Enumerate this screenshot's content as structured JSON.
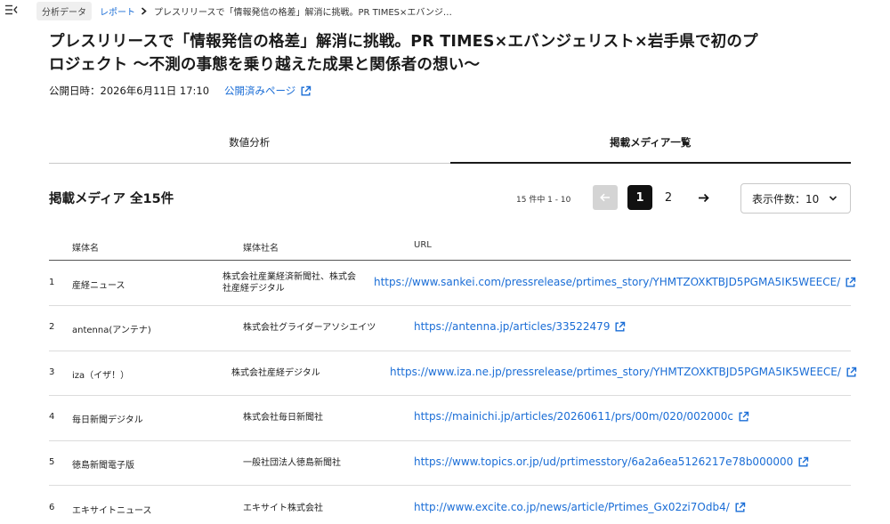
{
  "breadcrumb": {
    "root": "分析データ",
    "report": "レポート",
    "current": "プレスリリースで「情報発信の格差」解消に挑戦。PR TIMES×エバンジ…"
  },
  "page_title": "プレスリリースで「情報発信の格差」解消に挑戦。PR TIMES×エバンジェリスト×岩手県で初のプロジェクト 〜不測の事態を乗り越えた成果と関係者の想い〜",
  "meta": {
    "published": "公開日時：2026年6月11日 17:10",
    "published_page_link": "公開済みページ"
  },
  "tabs": [
    {
      "label": "数値分析",
      "active": false
    },
    {
      "label": "掲載メディア一覧",
      "active": true
    }
  ],
  "list": {
    "count_label": "掲載メディア 全15件",
    "range_label": "15 件中 1 - 10",
    "pages": [
      "1",
      "2"
    ],
    "current_page": "1",
    "per_page_label": "表示件数：10"
  },
  "table": {
    "headers": [
      "媒体名",
      "媒体社名",
      "URL"
    ],
    "rows": [
      {
        "num": "1",
        "media": "産経ニュース",
        "company": "株式会社産業経済新聞社、株式会社産経デジタル",
        "url": "https://www.sankei.com/pressrelease/prtimes_story/YHMTZOXKTBJD5PGMA5IK5WEECE/"
      },
      {
        "num": "2",
        "media": "antenna(アンテナ)",
        "company": "株式会社グライダーアソシエイツ",
        "url": "https://antenna.jp/articles/33522479"
      },
      {
        "num": "3",
        "media": "iza（イザ！）",
        "company": "株式会社産経デジタル",
        "url": "https://www.iza.ne.jp/pressrelease/prtimes_story/YHMTZOXKTBJD5PGMA5IK5WEECE/"
      },
      {
        "num": "4",
        "media": "毎日新聞デジタル",
        "company": "株式会社毎日新聞社",
        "url": "https://mainichi.jp/articles/20260611/prs/00m/020/002000c"
      },
      {
        "num": "5",
        "media": "徳島新聞電子版",
        "company": "一般社団法人徳島新聞社",
        "url": "https://www.topics.or.jp/ud/prtimesstory/6a2a6ea5126217e78b000000"
      },
      {
        "num": "6",
        "media": "エキサイトニュース",
        "company": "エキサイト株式会社",
        "url": "http://www.excite.co.jp/news/article/Prtimes_Gx02zi7Odb4/"
      }
    ]
  },
  "colors": {
    "link": "#1a6dd6",
    "active_page": "#111111",
    "disabled": "#d4d4d4"
  },
  "icons": [
    "menu-toggle-icon",
    "chevron-right-icon",
    "external-link-icon",
    "arrow-left-icon",
    "arrow-right-icon",
    "chevron-down-icon"
  ]
}
